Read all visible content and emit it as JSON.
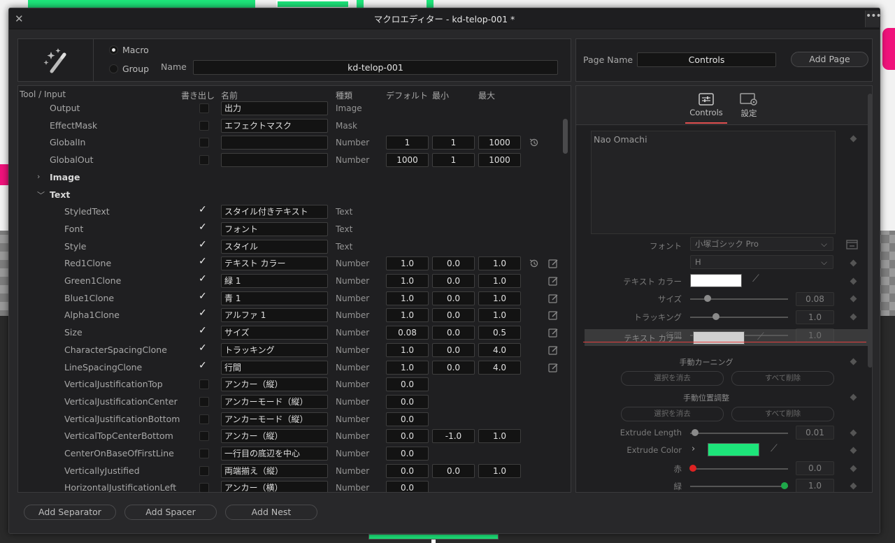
{
  "window": {
    "title": "マクロエディター - kd-telop-001 *"
  },
  "macro": {
    "type_options": [
      {
        "label": "Macro",
        "selected": true
      },
      {
        "label": "Group",
        "selected": false
      }
    ],
    "name_label": "Name",
    "name_value": "kd-telop-001"
  },
  "page": {
    "label": "Page Name",
    "value": "Controls",
    "add_button": "Add Page"
  },
  "table": {
    "headers": {
      "tool": "Tool / Input",
      "export": "書き出し",
      "name": "名前",
      "type": "種類",
      "default": "デフォルト",
      "min": "最小",
      "max": "最大"
    },
    "rows": [
      {
        "label": "Output",
        "checked": false,
        "name": "出力",
        "type": "Image"
      },
      {
        "label": "EffectMask",
        "checked": false,
        "name": "エフェクトマスク",
        "type": "Mask"
      },
      {
        "label": "GlobalIn",
        "checked": false,
        "name": "",
        "type": "Number",
        "def": "1",
        "min": "1",
        "max": "1000",
        "reset": true
      },
      {
        "label": "GlobalOut",
        "checked": false,
        "name": "",
        "type": "Number",
        "def": "1000",
        "min": "1",
        "max": "1000"
      },
      {
        "label": "Image",
        "group": true,
        "expanded": false
      },
      {
        "label": "Text",
        "group": true,
        "expanded": true
      },
      {
        "label": "StyledText",
        "checked": true,
        "name": "スタイル付きテキスト",
        "type": "Text"
      },
      {
        "label": "Font",
        "checked": true,
        "name": "フォント",
        "type": "Text"
      },
      {
        "label": "Style",
        "checked": true,
        "name": "スタイル",
        "type": "Text"
      },
      {
        "label": "Red1Clone",
        "checked": true,
        "name": "テキスト カラー",
        "type": "Number",
        "def": "1.0",
        "min": "0.0",
        "max": "1.0",
        "reset": true,
        "edit": true
      },
      {
        "label": "Green1Clone",
        "checked": true,
        "name": "緑 1",
        "type": "Number",
        "def": "1.0",
        "min": "0.0",
        "max": "1.0",
        "edit": true
      },
      {
        "label": "Blue1Clone",
        "checked": true,
        "name": "青 1",
        "type": "Number",
        "def": "1.0",
        "min": "0.0",
        "max": "1.0",
        "edit": true
      },
      {
        "label": "Alpha1Clone",
        "checked": true,
        "name": "アルファ 1",
        "type": "Number",
        "def": "1.0",
        "min": "0.0",
        "max": "1.0",
        "edit": true
      },
      {
        "label": "Size",
        "checked": true,
        "name": "サイズ",
        "type": "Number",
        "def": "0.08",
        "min": "0.0",
        "max": "0.5",
        "edit": true
      },
      {
        "label": "CharacterSpacingClone",
        "checked": true,
        "name": "トラッキング",
        "type": "Number",
        "def": "1.0",
        "min": "0.0",
        "max": "4.0",
        "edit": true
      },
      {
        "label": "LineSpacingClone",
        "checked": true,
        "name": "行間",
        "type": "Number",
        "def": "1.0",
        "min": "0.0",
        "max": "4.0",
        "edit": true
      },
      {
        "label": "VerticalJustificationTop",
        "checked": false,
        "name": "アンカー（縦）",
        "type": "Number",
        "def": "0.0"
      },
      {
        "label": "VerticalJustificationCenter",
        "checked": false,
        "name": "アンカーモード（縦）",
        "type": "Number",
        "def": "0.0"
      },
      {
        "label": "VerticalJustificationBottom",
        "checked": false,
        "name": "アンカーモード（縦）",
        "type": "Number",
        "def": "0.0"
      },
      {
        "label": "VerticalTopCenterBottom",
        "checked": false,
        "name": "アンカー（縦）",
        "type": "Number",
        "def": "0.0",
        "min": "-1.0",
        "max": "1.0"
      },
      {
        "label": "CenterOnBaseOfFirstLine",
        "checked": false,
        "name": "一行目の底辺を中心",
        "type": "Number",
        "def": "0.0"
      },
      {
        "label": "VerticallyJustified",
        "checked": false,
        "name": "両端揃え（縦）",
        "type": "Number",
        "def": "0.0",
        "min": "0.0",
        "max": "1.0"
      },
      {
        "label": "HorizontalJustificationLeft",
        "checked": false,
        "name": "アンカー（横）",
        "type": "Number",
        "def": "0.0"
      }
    ]
  },
  "inspector": {
    "tabs": [
      {
        "label": "Controls",
        "icon": "sliders-icon",
        "active": true
      },
      {
        "label": "設定",
        "icon": "gear-settings-icon",
        "active": false
      }
    ],
    "styled_text": "Nao Omachi",
    "font_label": "フォント",
    "font_value": "小塚ゴシック Pro",
    "style_value": "H",
    "text_color_label": "テキスト カラー",
    "size_label": "サイズ",
    "size_value": "0.08",
    "size_level": 0.16,
    "tracking_label": "トラッキング",
    "tracking_value": "1.0",
    "tracking_level": 0.25,
    "linespacing_label": "行間",
    "linespacing_value": "1.0",
    "linespacing_level": 0.25,
    "drag_label": "テキスト カラー",
    "manual_kerning_label": "手動カーニング",
    "clear_selection": "選択を消去",
    "delete_all": "すべて削除",
    "manual_position_label": "手動位置調整",
    "extrude_length_label": "Extrude Length",
    "extrude_length_value": "0.01",
    "extrude_length_level": 0.01,
    "extrude_color_label": "Extrude Color",
    "extrude_color": "#1de57a",
    "red_label": "赤",
    "red_value": "0.0",
    "red_level": 0.0,
    "green_label": "緑",
    "green_value": "1.0",
    "green_level": 1.0
  },
  "bottom_buttons": {
    "add_separator": "Add Separator",
    "add_spacer": "Add Spacer",
    "add_nest": "Add Nest"
  }
}
